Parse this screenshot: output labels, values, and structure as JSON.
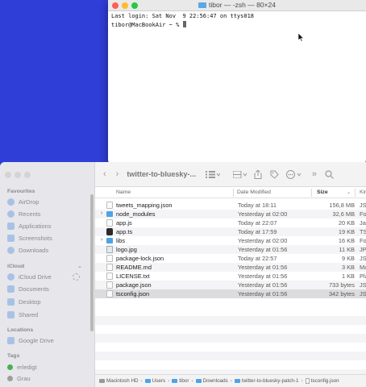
{
  "terminal": {
    "title": "tibor — -zsh — 80×24",
    "line1": "Last login: Sat Nov  9 22:56:47 on ttys018",
    "prompt": "tibor@MacBookAir ~ % "
  },
  "finder": {
    "toolbar": {
      "back": "‹",
      "forward": "›",
      "title": "twitter-to-bluesky-...",
      "more": "»",
      "search": "⌕"
    },
    "sidebar": {
      "favourites_title": "Favourites",
      "favourites": [
        "AirDrop",
        "Recents",
        "Applications",
        "Screenshots",
        "Downloads"
      ],
      "icloud_title": "iCloud",
      "icloud": [
        "iCloud Drive",
        "Documents",
        "Desktop",
        "Shared"
      ],
      "locations_title": "Locations",
      "locations": [
        "Google Drive"
      ],
      "tags_title": "Tags",
      "tags": [
        {
          "label": "erledigt",
          "color": "#4caf50"
        },
        {
          "label": "Grau",
          "color": "#9e9e9e"
        }
      ]
    },
    "columns": {
      "name": "Name",
      "date": "Date Modified",
      "size": "Size",
      "kind": "Kin"
    },
    "files": [
      {
        "name": "tweets_mapping.json",
        "date": "Today at 18:11",
        "size": "156,8 MB",
        "kind": "JS",
        "icon": "doc",
        "folder": false
      },
      {
        "name": "node_modules",
        "date": "Yesterday at 02:00",
        "size": "32,6 MB",
        "kind": "Fo",
        "icon": "folder",
        "folder": true
      },
      {
        "name": "app.js",
        "date": "Today at 22:07",
        "size": "20 KB",
        "kind": "Ja",
        "icon": "doc",
        "folder": false
      },
      {
        "name": "app.ts",
        "date": "Today at 17:59",
        "size": "19 KB",
        "kind": "TS",
        "icon": "dark",
        "folder": false
      },
      {
        "name": "libs",
        "date": "Yesterday at 02:00",
        "size": "16 KB",
        "kind": "Fo",
        "icon": "folder",
        "folder": true
      },
      {
        "name": "logo.jpg",
        "date": "Yesterday at 01:56",
        "size": "11 KB",
        "kind": "JP",
        "icon": "image",
        "folder": false
      },
      {
        "name": "package-lock.json",
        "date": "Today at 22:57",
        "size": "9 KB",
        "kind": "JS",
        "icon": "doc",
        "folder": false
      },
      {
        "name": "README.md",
        "date": "Yesterday at 01:56",
        "size": "3 KB",
        "kind": "Ma",
        "icon": "doc",
        "folder": false
      },
      {
        "name": "LICENSE.txt",
        "date": "Yesterday at 01:56",
        "size": "1 KB",
        "kind": "Pla",
        "icon": "doc",
        "folder": false
      },
      {
        "name": "package.json",
        "date": "Yesterday at 01:56",
        "size": "733 bytes",
        "kind": "JS",
        "icon": "doc",
        "folder": false
      },
      {
        "name": "tsconfig.json",
        "date": "Yesterday at 01:56",
        "size": "342 bytes",
        "kind": "JS",
        "icon": "doc",
        "folder": false,
        "selected": true
      }
    ],
    "pathbar": [
      "Macintosh HD",
      "Users",
      "tibor",
      "Downloads",
      "twitter-to-bluesky-patch-1",
      "tsconfig.json"
    ]
  }
}
